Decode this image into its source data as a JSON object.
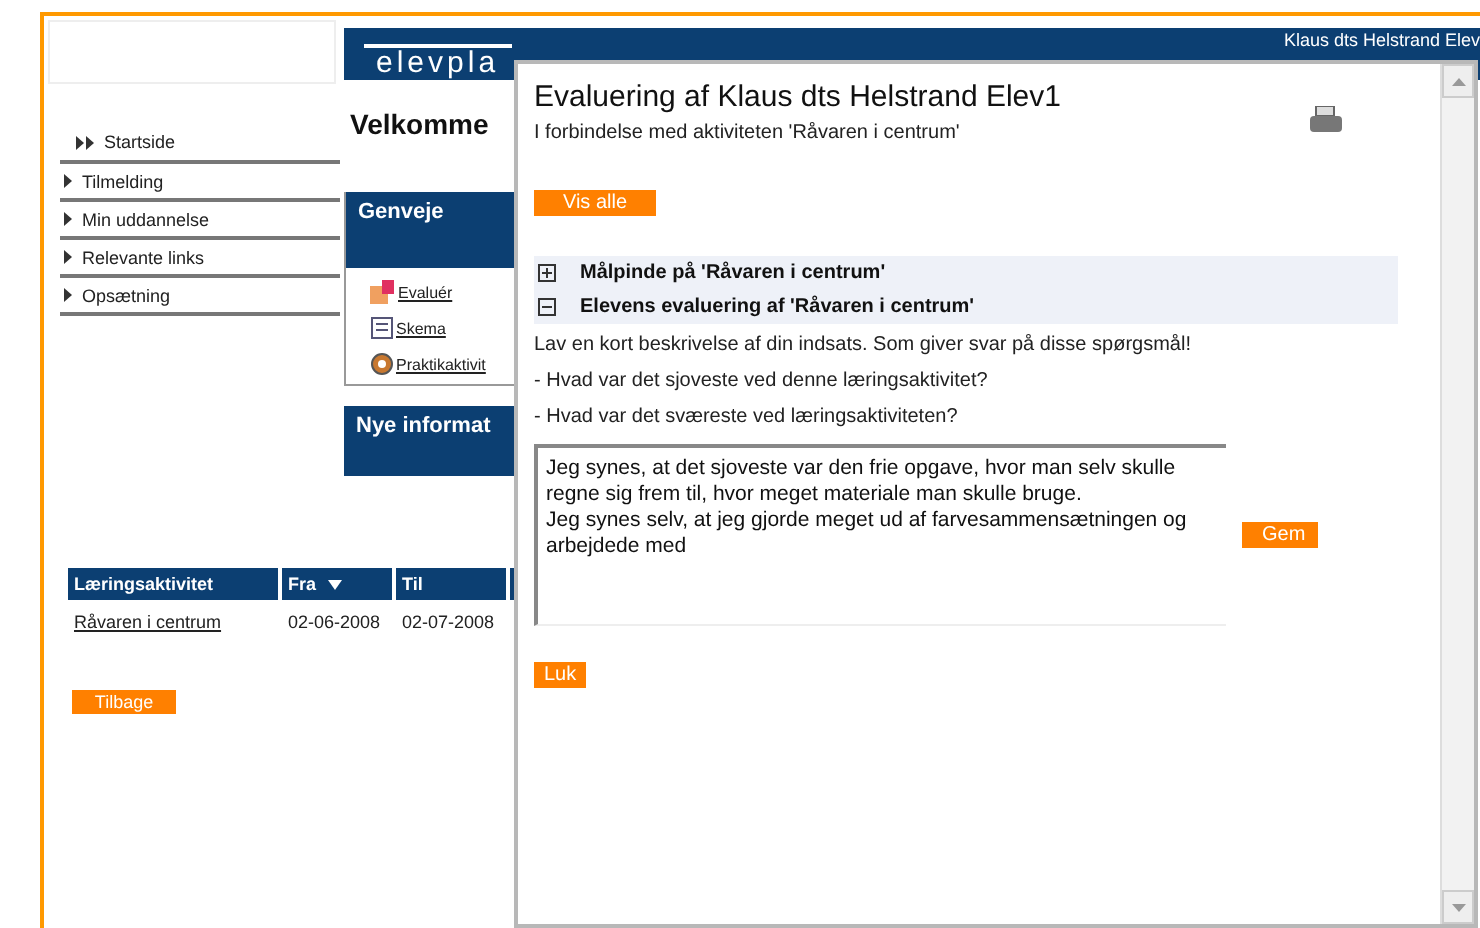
{
  "header": {
    "logo": "elevpla",
    "user": "Klaus dts Helstrand Elev"
  },
  "nav": [
    {
      "label": "Startside",
      "selected": true
    },
    {
      "label": "Tilmelding",
      "selected": false
    },
    {
      "label": "Min uddannelse",
      "selected": false
    },
    {
      "label": "Relevante links",
      "selected": false
    },
    {
      "label": "Opsætning",
      "selected": false
    }
  ],
  "welcome": "Velkomme",
  "shortcuts": {
    "title": "Genveje",
    "items": [
      {
        "label": "Evaluér",
        "kind": "evaluate"
      },
      {
        "label": "Skema",
        "kind": "schedule"
      },
      {
        "label": "Praktikaktivit",
        "kind": "gear"
      }
    ]
  },
  "news": {
    "title": "Nye informat"
  },
  "table": {
    "columns": [
      {
        "label": "Læringsaktivitet",
        "sorted": false
      },
      {
        "label": "Fra",
        "sorted": true
      },
      {
        "label": "Til",
        "sorted": false
      }
    ],
    "rows": [
      {
        "cells": [
          "Råvaren i centrum",
          "02-06-2008",
          "02-07-2008"
        ]
      }
    ]
  },
  "back_button": "Tilbage",
  "dialog": {
    "title": "Evaluering af Klaus dts Helstrand Elev1",
    "subtitle": "I forbindelse med aktiviteten 'Råvaren i centrum'",
    "show_all": "Vis alle",
    "sections": [
      {
        "label": "Målpinde på 'Råvaren i centrum'",
        "expanded": false
      },
      {
        "label": "Elevens evaluering af 'Råvaren i centrum'",
        "expanded": true
      }
    ],
    "instructions": [
      "Lav en kort beskrivelse af din indsats. Som giver svar på disse spørgsmål!",
      "- Hvad var det sjoveste ved denne læringsaktivitet?",
      "- Hvad var det sværeste ved læringsaktiviteten?"
    ],
    "answer": "Jeg synes, at det sjoveste var den frie opgave, hvor man selv skulle regne sig frem til, hvor meget materiale man skulle bruge.\nJeg synes selv, at jeg gjorde meget ud af farvesammensætningen og arbejdede med",
    "save": "Gem",
    "close": "Luk"
  }
}
